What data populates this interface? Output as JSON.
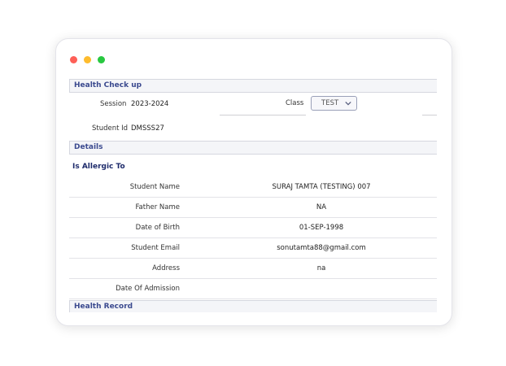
{
  "sections": {
    "health_check": "Health Check up",
    "details": "Details",
    "health_record": "Health Record"
  },
  "form": {
    "session_label": "Session",
    "session_value": "2023-2024",
    "class_label": "Class",
    "class_value": "TEST",
    "student_id_label": "Student Id",
    "student_id_value": "DMSSS27"
  },
  "allergic_label": "Is Allergic To",
  "details": [
    {
      "label": "Student Name",
      "value": "SURAJ TAMTA (TESTING) 007"
    },
    {
      "label": "Father Name",
      "value": "NA"
    },
    {
      "label": "Date of Birth",
      "value": "01-SEP-1998"
    },
    {
      "label": "Student Email",
      "value": "sonutamta88@gmail.com"
    },
    {
      "label": "Address",
      "value": "na"
    },
    {
      "label": "Date Of Admission",
      "value": ""
    }
  ],
  "colors": {
    "accent": "#3b4a8f",
    "heading": "#1e2b6b"
  }
}
